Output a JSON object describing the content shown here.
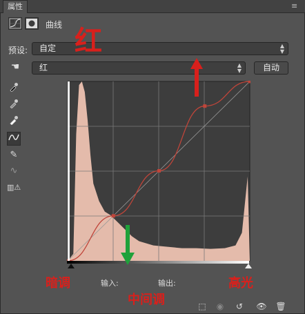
{
  "panel": {
    "tab_label": "属性",
    "menu_icon": "panel-menu-icon"
  },
  "header": {
    "title": "曲线",
    "icons": [
      "curves-adjustment-icon",
      "mask-icon"
    ]
  },
  "preset": {
    "label": "预设:",
    "value": "自定"
  },
  "channel": {
    "value": "红",
    "auto_label": "自动"
  },
  "tools": [
    "on-image-adjust-icon",
    "black-point-eyedropper-icon",
    "gray-point-eyedropper-icon",
    "white-point-eyedropper-icon",
    "curve-points-icon",
    "pencil-icon",
    "smooth-icon",
    "clipping-warning-icon"
  ],
  "io": {
    "input_label": "输入:",
    "output_label": "输出:"
  },
  "annotations": {
    "channel_note": "红",
    "shadows": "暗调",
    "midtones": "中间调",
    "highlights": "高光"
  },
  "bottom_icons": [
    "clip-to-layer-icon",
    "previous-state-icon",
    "reset-icon",
    "visibility-icon",
    "delete-icon"
  ],
  "colors": {
    "histogram": "#f2c6b4",
    "grid_bg": "#3d3d3d",
    "curve": "#c0453a",
    "red_annot": "#d8201c",
    "green_arrow": "#1fa13a"
  },
  "chart_data": {
    "type": "area",
    "title": "",
    "xlabel": "",
    "ylabel": "",
    "xlim": [
      0,
      255
    ],
    "ylim": [
      0,
      255
    ],
    "grid": "4x4",
    "histogram_series": {
      "x": [
        0,
        8,
        12,
        16,
        20,
        24,
        28,
        32,
        36,
        44,
        52,
        60,
        70,
        80,
        90,
        100,
        120,
        140,
        160,
        180,
        200,
        220,
        235,
        244,
        248,
        252,
        255
      ],
      "values": [
        0,
        10,
        180,
        250,
        255,
        240,
        200,
        150,
        110,
        85,
        70,
        65,
        55,
        45,
        35,
        28,
        22,
        20,
        18,
        18,
        17,
        18,
        22,
        40,
        80,
        120,
        0
      ]
    },
    "curve_points": {
      "x": [
        0,
        64,
        128,
        192,
        255
      ],
      "y": [
        0,
        64,
        128,
        220,
        255
      ]
    },
    "diagonal": {
      "x": [
        0,
        255
      ],
      "y": [
        0,
        255
      ]
    }
  }
}
